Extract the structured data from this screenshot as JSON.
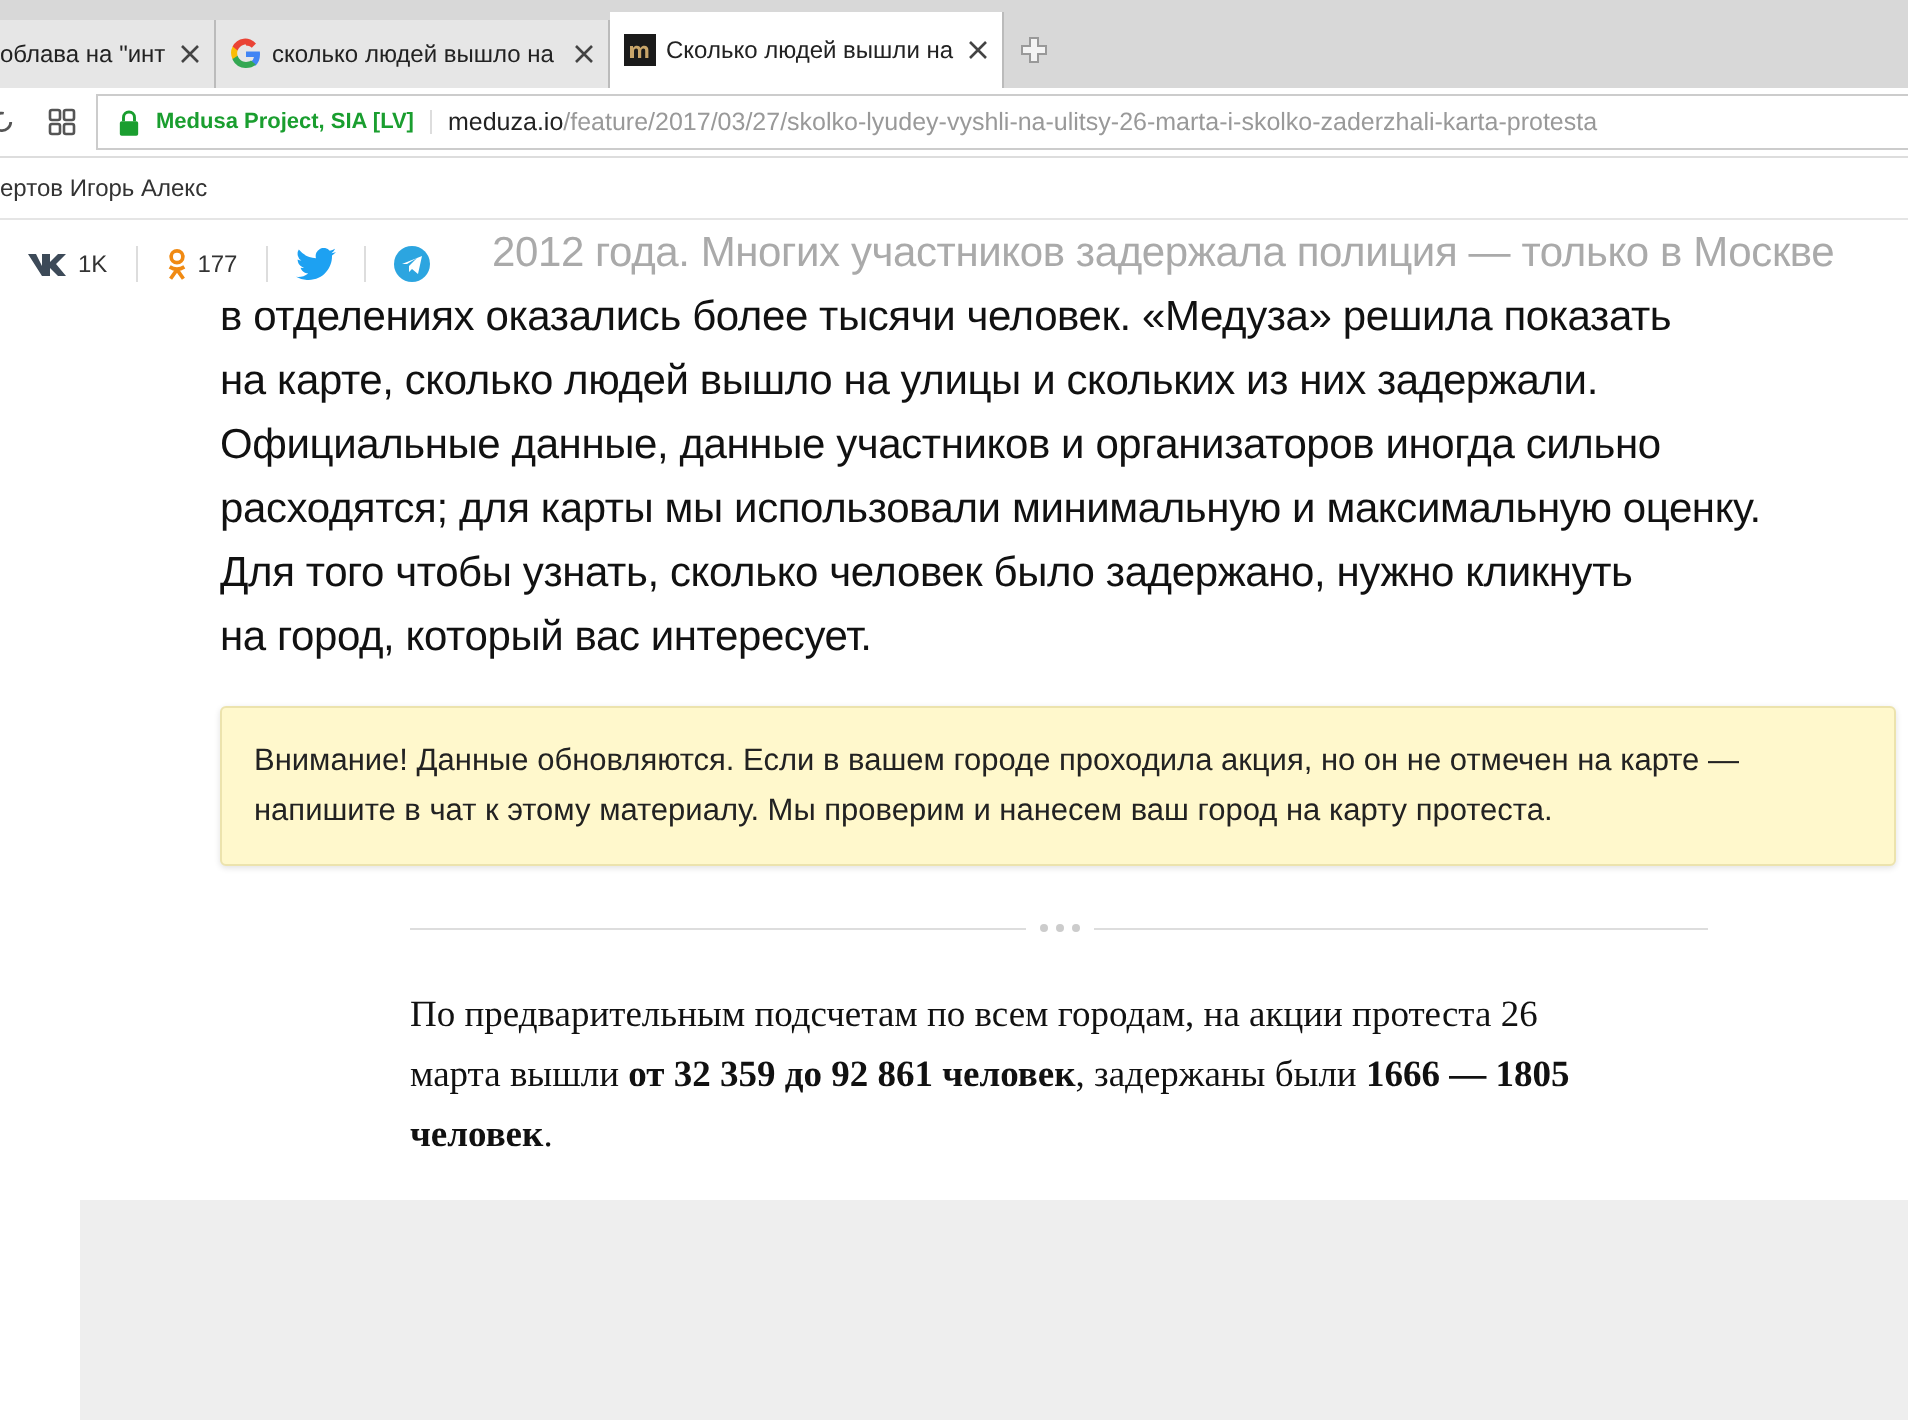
{
  "browser": {
    "tabs": [
      {
        "title": "облава на \"инт",
        "selected": false
      },
      {
        "title": "сколько людей вышло на",
        "selected": false
      },
      {
        "title": "Сколько людей вышли на",
        "selected": true
      }
    ],
    "site_identity": "Medusa Project, SIA [LV]",
    "url_host": "meduza.io",
    "url_path": "/feature/2017/03/27/skolko-lyudey-vyshli-na-ulitsy-26-marta-i-skolko-zaderzhali-karta-protesta",
    "bookmarks": [
      "ертов Игорь Алекс"
    ]
  },
  "share_bar": [
    {
      "count": "1K"
    },
    {
      "count": "177"
    }
  ],
  "article": {
    "lines": [
      "2012 года. Многих участников задержала полиция — только в Москве",
      "в отделениях оказались более тысячи человек. «Медуза» решила показать",
      "на карте, сколько людей вышло на улицы и скольких из них задержали.",
      "Официальные данные, данные участников и организаторов иногда сильно",
      "расходятся; для карты мы использовали минимальную и максимальную оценку.",
      "Для того чтобы узнать, сколько человек было задержано, нужно кликнуть",
      "на город, который вас интересует."
    ],
    "notice": "Внимание! Данные обновляются. Если в вашем городе проходила акция, но он не отмечен на карте — напишите в чат к этому материалу. Мы проверим и нанесем ваш город на карту протеста.",
    "summary": "По предварительным подсчетам по всем городам, на акции протеста 26 марта вышли **от 32 359 до 92 861 человек**, задержаны были **1666 — 1805 человек**."
  }
}
